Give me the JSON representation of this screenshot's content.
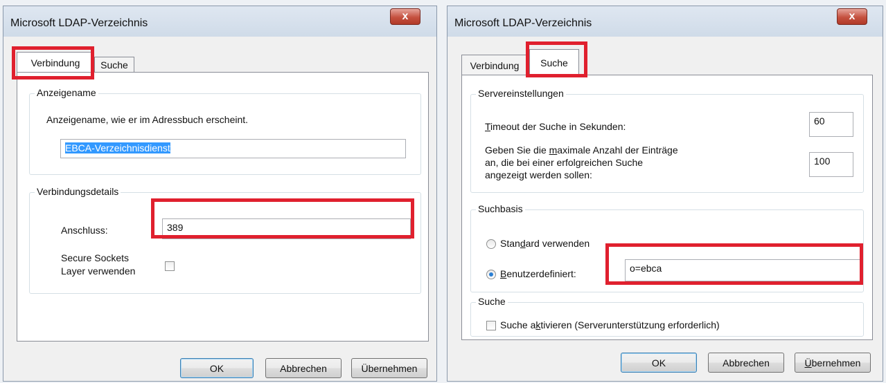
{
  "left_dialog": {
    "title": "Microsoft LDAP-Verzeichnis",
    "close_glyph": "x",
    "tabs": [
      "Verbindung",
      "Suche"
    ],
    "active_tab": "Verbindung",
    "display_group": {
      "legend": "Anzeigename",
      "description": "Anzeigename, wie er im Adressbuch erscheint.",
      "value": "EBCA-Verzeichnisdienst"
    },
    "connection_group": {
      "legend": "Verbindungsdetails",
      "port_label": "Anschluss:",
      "port_value": "389",
      "ssl_label_line1": "Secure Sockets",
      "ssl_label_line2": "Layer verwenden",
      "ssl_checked": false
    },
    "buttons": {
      "ok": "OK",
      "cancel": "Abbrechen",
      "apply": "Übernehmen"
    }
  },
  "right_dialog": {
    "title": "Microsoft LDAP-Verzeichnis",
    "close_glyph": "x",
    "tabs": [
      "Verbindung",
      "Suche"
    ],
    "active_tab": "Suche",
    "server_group": {
      "legend": "Servereinstellungen",
      "timeout_label_underline": "T",
      "timeout_label_rest": "imeout der Suche in Sekunden:",
      "timeout_value": "60",
      "max_label_line1_a": "Geben Sie die ",
      "max_label_line1_u": "m",
      "max_label_line1_b": "aximale Anzahl der Einträge",
      "max_label_line2": "an, die bei einer erfolgreichen Suche",
      "max_label_line3": "angezeigt werden sollen:",
      "max_value": "100"
    },
    "base_group": {
      "legend": "Suchbasis",
      "standard_a": "Stan",
      "standard_u": "d",
      "standard_b": "ard verwenden",
      "custom_u": "B",
      "custom_rest": "enutzerdefiniert:",
      "custom_value": "o=ebca",
      "selected": "custom"
    },
    "search_group": {
      "legend": "Suche",
      "enable_a": "Suche a",
      "enable_u": "k",
      "enable_b": "tivieren (Serverunterstützung erforderlich)",
      "enabled": false
    },
    "buttons": {
      "ok": "OK",
      "cancel": "Abbrechen",
      "apply_u": "Ü",
      "apply_rest": "bernehmen"
    }
  },
  "highlight_color": "#e0202e"
}
